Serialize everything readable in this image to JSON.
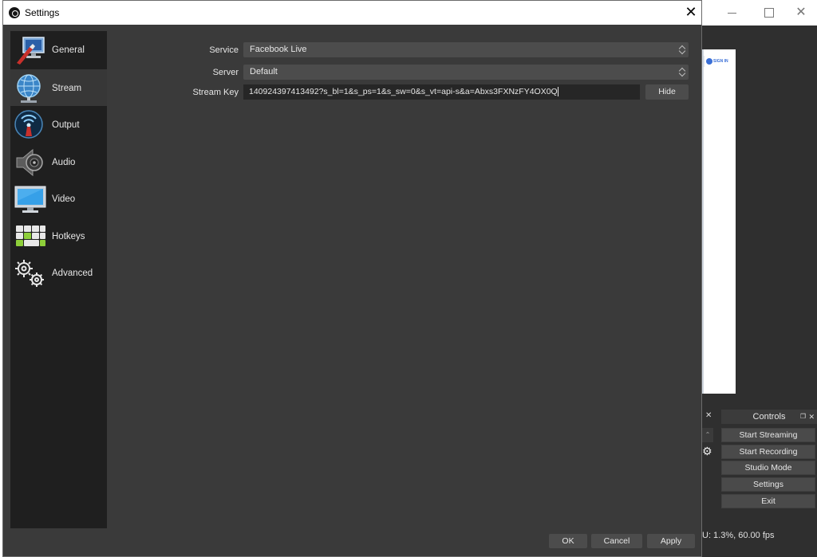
{
  "dialog": {
    "title": "Settings",
    "close_glyph": "✕"
  },
  "sidebar": {
    "items": [
      {
        "label": "General",
        "icon": "general-icon"
      },
      {
        "label": "Stream",
        "icon": "stream-globe-icon",
        "active": true
      },
      {
        "label": "Output",
        "icon": "output-signal-icon"
      },
      {
        "label": "Audio",
        "icon": "speaker-icon"
      },
      {
        "label": "Video",
        "icon": "monitor-icon"
      },
      {
        "label": "Hotkeys",
        "icon": "keyboard-icon"
      },
      {
        "label": "Advanced",
        "icon": "gears-icon"
      }
    ]
  },
  "stream": {
    "service_label": "Service",
    "service_value": "Facebook Live",
    "server_label": "Server",
    "server_value": "Default",
    "key_label": "Stream Key",
    "key_value": "140924397413492?s_bl=1&s_ps=1&s_sw=0&s_vt=api-s&a=Abxs3FXNzFY4OX0Q",
    "hide_label": "Hide"
  },
  "footer": {
    "ok": "OK",
    "cancel": "Cancel",
    "apply": "Apply"
  },
  "background_window": {
    "close_glyph": "✕",
    "preview_signin": "SIGN IN",
    "controls_title": "Controls",
    "controls_buttons": [
      "Start Streaming",
      "Start Recording",
      "Studio Mode",
      "Settings",
      "Exit"
    ],
    "status": "U: 1.3%, 60.00 fps"
  },
  "colors": {
    "dialog_bg": "#3a3a3a",
    "sidebar_bg": "#1f1f1f",
    "active_item": "#373737",
    "control": "#4c4c4c",
    "input_bg": "#262626",
    "text": "#e6e6e6"
  }
}
